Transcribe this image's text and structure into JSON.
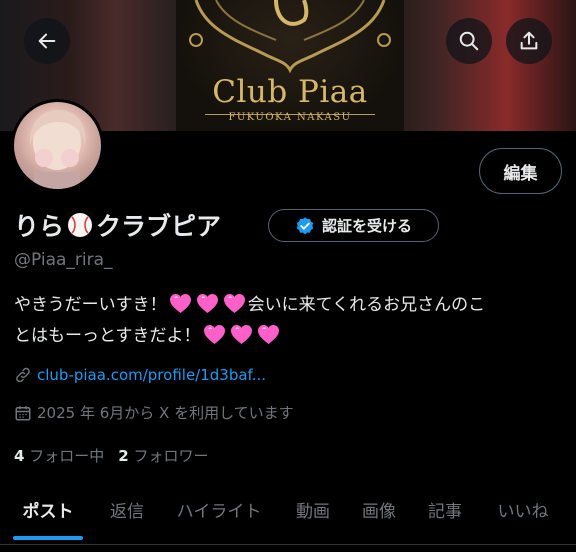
{
  "banner": {
    "brand": "Club Piaa",
    "brand_sub": "FUKUOKA NAKASU"
  },
  "header": {
    "back_icon": "arrow-left-icon",
    "search_icon": "search-icon",
    "share_icon": "share-icon"
  },
  "profile": {
    "name_part1": "りら",
    "name_emoji": "baseball-icon",
    "name_part2": "クラブピア",
    "handle": "@Piaa_rira_",
    "edit_label": "編集",
    "verify_label": "認証を受ける",
    "bio_line1_text": "やきうだーいすき！",
    "bio_line1_text2": "会いに来てくれるお兄さんのこ",
    "bio_line2_text": "とはもーっとすきだよ！",
    "link": "club-piaa.com/profile/1d3baf...",
    "joined": "2025 年 6月から X を利用しています",
    "following_count": "4",
    "following_label": "フォロー中",
    "followers_count": "2",
    "followers_label": "フォロワー"
  },
  "tabs": [
    {
      "label": "ポスト",
      "active": true
    },
    {
      "label": "返信",
      "active": false
    },
    {
      "label": "ハイライト",
      "active": false
    },
    {
      "label": "動画",
      "active": false
    },
    {
      "label": "画像",
      "active": false
    },
    {
      "label": "記事",
      "active": false
    },
    {
      "label": "いいね",
      "active": false
    }
  ],
  "colors": {
    "accent": "#1d9bf0",
    "secondary_text": "#71767b",
    "heart": "#ff5fc8",
    "gold": "#d6b76a"
  }
}
